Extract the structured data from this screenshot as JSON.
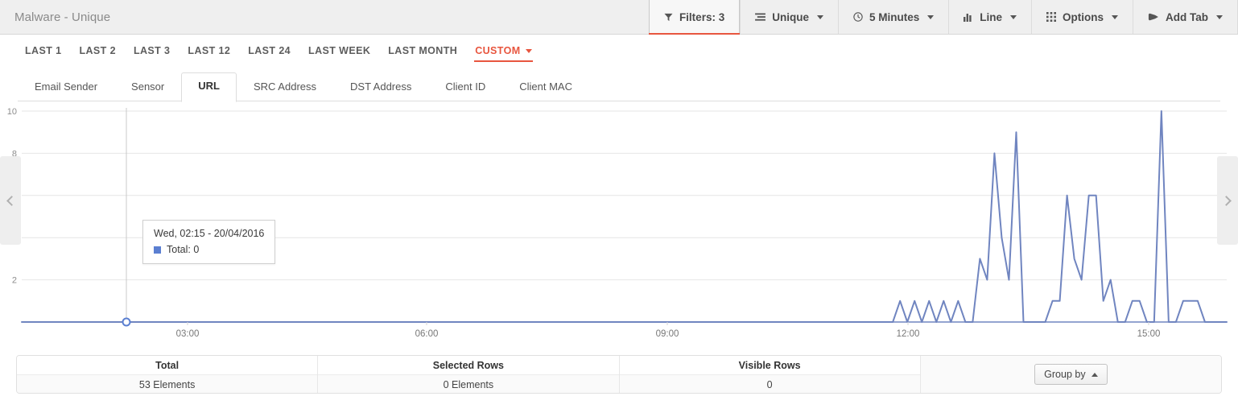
{
  "header": {
    "app_title": "Malware - Unique",
    "toolbar": [
      {
        "label": "Filters: 3",
        "icon": "funnel-icon",
        "active": true,
        "caret": false
      },
      {
        "label": "Unique",
        "icon": "list-icon",
        "active": false,
        "caret": true
      },
      {
        "label": "5 Minutes",
        "icon": "clock-icon",
        "active": false,
        "caret": true
      },
      {
        "label": "Line",
        "icon": "chart-icon",
        "active": false,
        "caret": true
      },
      {
        "label": "Options",
        "icon": "grid-icon",
        "active": false,
        "caret": true
      },
      {
        "label": "Add Tab",
        "icon": "tag-icon",
        "active": false,
        "caret": true
      }
    ]
  },
  "range_bar": {
    "items": [
      {
        "label": "LAST 1",
        "active": false,
        "caret": false
      },
      {
        "label": "LAST 2",
        "active": false,
        "caret": false
      },
      {
        "label": "LAST 3",
        "active": false,
        "caret": false
      },
      {
        "label": "LAST 12",
        "active": false,
        "caret": false
      },
      {
        "label": "LAST 24",
        "active": false,
        "caret": false
      },
      {
        "label": "LAST WEEK",
        "active": false,
        "caret": false
      },
      {
        "label": "LAST MONTH",
        "active": false,
        "caret": false
      },
      {
        "label": "CUSTOM",
        "active": true,
        "caret": true
      }
    ]
  },
  "tabs": {
    "items": [
      {
        "label": "Email Sender",
        "active": false
      },
      {
        "label": "Sensor",
        "active": false
      },
      {
        "label": "URL",
        "active": true
      },
      {
        "label": "SRC Address",
        "active": false
      },
      {
        "label": "DST Address",
        "active": false
      },
      {
        "label": "Client ID",
        "active": false
      },
      {
        "label": "Client MAC",
        "active": false
      }
    ]
  },
  "tooltip": {
    "title": "Wed, 02:15 - 20/04/2016",
    "series_label": "Total: 0",
    "swatch_color": "#5b7fd1"
  },
  "nav": {
    "prev_icon": "chevron-left-icon",
    "next_icon": "chevron-right-icon"
  },
  "summary": {
    "columns": [
      {
        "header": "Total",
        "value": "53 Elements"
      },
      {
        "header": "Selected Rows",
        "value": "0 Elements"
      },
      {
        "header": "Visible Rows",
        "value": "0"
      }
    ],
    "group_by_label": "Group by",
    "group_by_caret": "caret-up-icon"
  },
  "chart_data": {
    "type": "line",
    "title": "",
    "xlabel": "",
    "ylabel": "",
    "ylim": [
      0,
      10
    ],
    "yticks": [
      2,
      4,
      6,
      8,
      10
    ],
    "grid": true,
    "legend": "none",
    "line_color": "#7085c0",
    "marker": {
      "x_label": "02:15",
      "value": 0,
      "shape": "circle",
      "color": "#5b7fd1"
    },
    "xticks": [
      "03:00",
      "06:00",
      "09:00",
      "12:00",
      "15:00"
    ],
    "x_tick_positions": [
      233,
      530,
      829,
      1128,
      1427
    ],
    "x_start_label": "02:15",
    "series": [
      {
        "name": "Total",
        "x": [
          "02:15",
          "02:20",
          "02:25",
          "02:30",
          "02:35",
          "02:40",
          "02:45",
          "02:50",
          "02:55",
          "03:00",
          "03:05",
          "03:10",
          "03:15",
          "03:20",
          "03:25",
          "03:30",
          "03:35",
          "03:40",
          "03:45",
          "03:50",
          "03:55",
          "04:00",
          "04:05",
          "04:10",
          "04:15",
          "04:20",
          "04:25",
          "04:30",
          "04:35",
          "04:40",
          "04:45",
          "04:50",
          "04:55",
          "05:00",
          "05:05",
          "05:10",
          "05:15",
          "05:20",
          "05:25",
          "05:30",
          "05:35",
          "05:40",
          "05:45",
          "05:50",
          "05:55",
          "06:00",
          "06:05",
          "06:10",
          "06:15",
          "06:20",
          "06:25",
          "06:30",
          "06:35",
          "06:40",
          "06:45",
          "06:50",
          "06:55",
          "07:00",
          "07:05",
          "07:10",
          "07:15",
          "07:20",
          "07:25",
          "07:30",
          "07:35",
          "07:40",
          "07:45",
          "07:50",
          "07:55",
          "08:00",
          "08:05",
          "08:10",
          "08:15",
          "08:20",
          "08:25",
          "08:30",
          "08:35",
          "08:40",
          "08:45",
          "08:50",
          "08:55",
          "09:00",
          "09:05",
          "09:10",
          "09:15",
          "09:20",
          "09:25",
          "09:30",
          "09:35",
          "09:40",
          "09:45",
          "09:50",
          "09:55",
          "10:00",
          "10:05",
          "10:10",
          "10:15",
          "10:20",
          "10:25",
          "10:30",
          "10:35",
          "10:40",
          "10:45",
          "10:50",
          "10:55",
          "11:00",
          "11:05",
          "11:10",
          "11:15",
          "11:20",
          "11:25",
          "11:30",
          "11:35",
          "11:40",
          "11:45",
          "11:50",
          "11:55",
          "12:00",
          "12:05",
          "12:10",
          "12:15",
          "12:20",
          "12:25",
          "12:30",
          "12:35",
          "12:40",
          "12:45",
          "12:50",
          "12:55",
          "13:00",
          "13:05",
          "13:10",
          "13:15",
          "13:20",
          "13:25",
          "13:30",
          "13:35",
          "13:40",
          "13:45",
          "13:50",
          "13:55",
          "14:00",
          "14:05",
          "14:10",
          "14:15",
          "14:20",
          "14:25",
          "14:30",
          "14:35",
          "14:40",
          "14:45",
          "14:50",
          "14:55",
          "15:00",
          "15:05",
          "15:10",
          "15:15",
          "15:20",
          "15:25",
          "15:30",
          "15:35",
          "15:40",
          "15:45",
          "15:50",
          "15:55",
          "16:00",
          "16:05"
        ],
        "values": [
          0,
          0,
          0,
          0,
          0,
          0,
          0,
          0,
          0,
          0,
          0,
          0,
          0,
          0,
          0,
          0,
          0,
          0,
          0,
          0,
          0,
          0,
          0,
          0,
          0,
          0,
          0,
          0,
          0,
          0,
          0,
          0,
          0,
          0,
          0,
          0,
          0,
          0,
          0,
          0,
          0,
          0,
          0,
          0,
          0,
          0,
          0,
          0,
          0,
          0,
          0,
          0,
          0,
          0,
          0,
          0,
          0,
          0,
          0,
          0,
          0,
          0,
          0,
          0,
          0,
          0,
          0,
          0,
          0,
          0,
          0,
          0,
          0,
          0,
          0,
          0,
          0,
          0,
          0,
          0,
          0,
          0,
          0,
          0,
          0,
          0,
          0,
          0,
          0,
          0,
          0,
          0,
          0,
          0,
          0,
          0,
          0,
          0,
          0,
          0,
          0,
          0,
          0,
          0,
          0,
          0,
          0,
          0,
          0,
          0,
          0,
          0,
          0,
          0,
          0,
          0,
          0,
          0,
          0,
          0,
          0,
          1,
          0,
          1,
          0,
          1,
          0,
          1,
          0,
          1,
          0,
          0,
          3,
          2,
          8,
          4,
          2,
          9,
          0,
          0,
          0,
          0,
          1,
          1,
          6,
          3,
          2,
          6,
          6,
          1,
          2,
          0,
          0,
          1,
          1,
          0,
          0,
          10,
          0,
          0,
          1,
          1,
          1,
          0,
          0,
          0,
          0
        ]
      }
    ]
  }
}
